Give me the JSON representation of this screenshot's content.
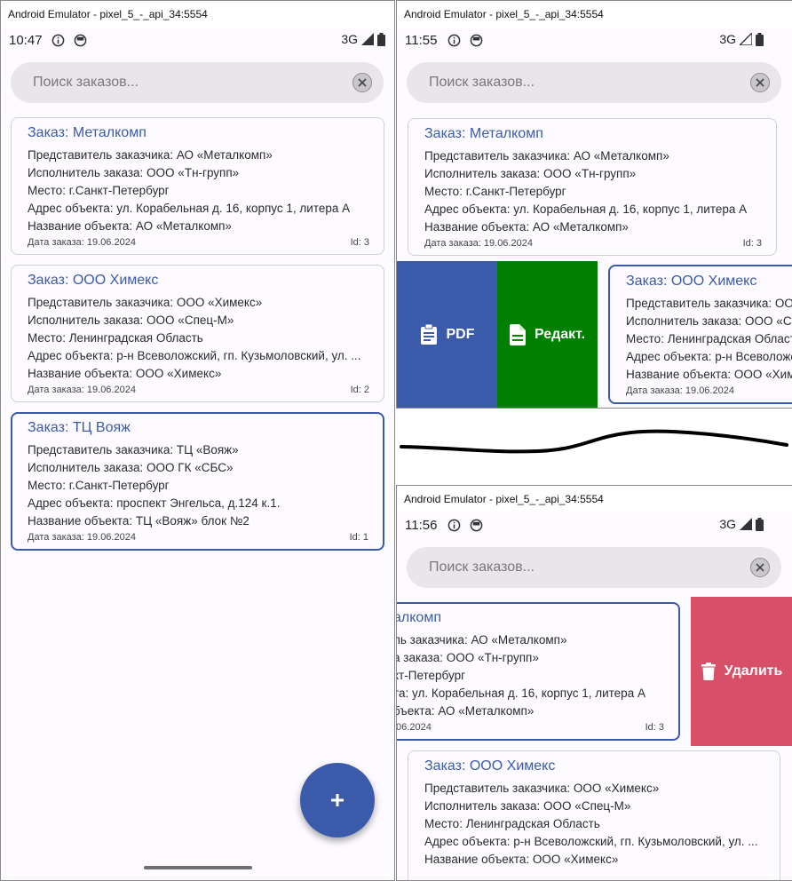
{
  "window_title": "Android Emulator - pixel_5_-_api_34:5554",
  "status": {
    "time_1": "10:47",
    "time_2": "11:55",
    "time_3": "11:56",
    "network": "3G"
  },
  "search": {
    "placeholder": "Поиск заказов..."
  },
  "orders": [
    {
      "title": "Заказ: Металкомп",
      "representative": "Представитель заказчика: АО «Металкомп»",
      "executor": "Исполнитель заказа: ООО «Тн-групп»",
      "place": "Место: г.Санкт-Петербург",
      "address": "Адрес объекта: ул. Корабельная д. 16, корпус 1, литера А",
      "object": "Название объекта: АО «Металкомп»",
      "date": "Дата заказа: 19.06.2024",
      "id": "Id: 3"
    },
    {
      "title": "Заказ: ООО Химекс",
      "representative": "Представитель заказчика: ООО «Химекс»",
      "executor": "Исполнитель заказа: ООО «Спец-М»",
      "place": "Место: Ленинградская Область",
      "address": "Адрес объекта: р-н Всеволожский, гп. Кузьмоловский, ул. ...",
      "object": "Название объекта: ООО «Химекс»",
      "date": "Дата заказа: 19.06.2024",
      "id": "Id: 2"
    },
    {
      "title": "Заказ: ТЦ Вояж",
      "representative": "Представитель заказчика: ТЦ «Вояж»",
      "executor": "Исполнитель заказа: ООО ГК «СБС»",
      "place": "Место: г.Санкт-Петербург",
      "address": "Адрес объекта: проспект Энгельса, д.124 к.1.",
      "object": "Название объекта: ТЦ «Вояж» блок №2",
      "date": "Дата заказа: 19.06.2024",
      "id": "Id: 1"
    }
  ],
  "partial_card_3": {
    "title": "алкомп",
    "representative": "ль заказчика: АО «Металкомп»",
    "executor": "а заказа: ООО «Тн-групп»",
    "place": "кт-Петербург",
    "address": "та: ул. Корабельная д. 16, корпус 1, литера А",
    "object": "бъекта: АО «Металкомп»",
    "date": ".06.2024",
    "id": "Id: 3"
  },
  "swipe_actions": {
    "pdf": "PDF",
    "edit": "Редакт.",
    "delete": "Удалить"
  },
  "colors": {
    "accent": "#3b5baa",
    "pdf_bg": "#3b5baa",
    "edit_bg": "#008000",
    "delete_bg": "#d84f68"
  }
}
